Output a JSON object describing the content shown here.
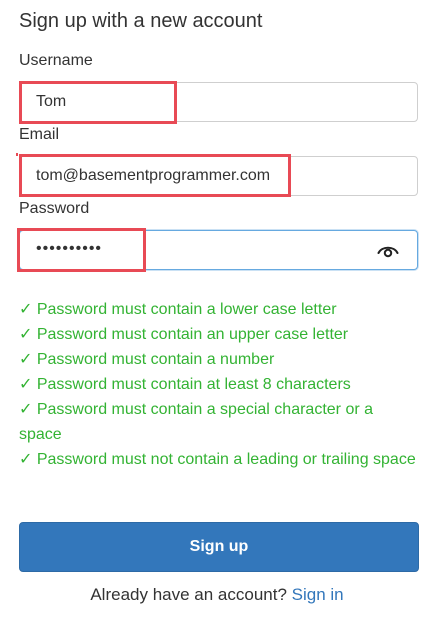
{
  "form": {
    "title": "Sign up with a new account",
    "username": {
      "label": "Username",
      "value": "Tom"
    },
    "email": {
      "label": "Email",
      "value": "tom@basementprogrammer.com"
    },
    "password": {
      "label": "Password",
      "masked_value": "••••••••••",
      "toggle_icon": "eye-icon"
    },
    "rules": [
      "✓ Password must contain a lower case letter",
      "✓ Password must contain an upper case letter",
      "✓ Password must contain a number",
      "✓ Password must contain at least 8 characters",
      "✓ Password must contain a special character or a space",
      "✓ Password must not contain a leading or trailing space"
    ],
    "submit_label": "Sign up",
    "footer_text": "Already have an account? ",
    "footer_link": "Sign in"
  },
  "colors": {
    "rule_success": "#33b333",
    "button": "#3377bb",
    "link": "#3377bb",
    "highlight": "#e84a55",
    "focus_border": "#66a9e0"
  }
}
